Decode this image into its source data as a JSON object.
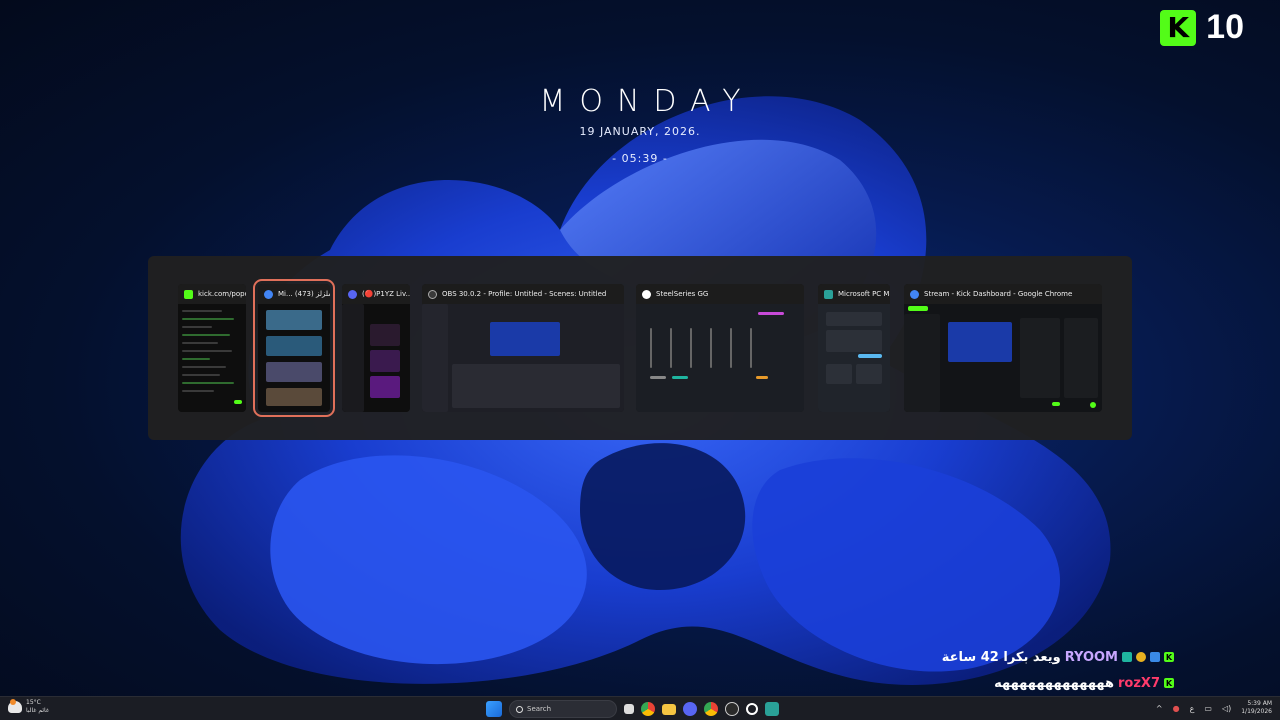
{
  "kick_overlay": {
    "viewer_count": "10",
    "logo_letter": "K"
  },
  "clock": {
    "day": "MONDAY",
    "date": "19 JANUARY, 2026.",
    "time": "- 05:39 -"
  },
  "switcher": {
    "windows": [
      {
        "title": "kick.com/popo...",
        "icon_color": "#53fc18",
        "selected": false
      },
      {
        "title": "Mi... ملزلز (473)",
        "icon_color": "#4285f4",
        "selected": true
      },
      {
        "title": "(🔴)P1YZ Liv...",
        "icon_color": "#5865f2",
        "selected": false
      },
      {
        "title": "OBS 30.0.2 - Profile: Untitled - Scenes: Untitled",
        "icon_color": "#3a3a3a",
        "selected": false
      },
      {
        "title": "SteelSeries GG",
        "icon_color": "#ffffff",
        "selected": false
      },
      {
        "title": "Microsoft PC Ma...",
        "icon_color": "#2aa198",
        "selected": false
      },
      {
        "title": "Stream - Kick Dashboard - Google Chrome",
        "icon_color": "#4285f4",
        "selected": false
      }
    ]
  },
  "chat": {
    "messages": [
      {
        "user": "RYOOM",
        "text": "ويعد بكرا 42 ساعة"
      },
      {
        "user": "rozX7",
        "text": "هههههههههههههه"
      },
      {
        "user": "rozX7",
        "text": ""
      }
    ]
  },
  "taskbar": {
    "weather": {
      "temp": "15°C",
      "desc": "غائم غالبا"
    },
    "search_placeholder": "Search",
    "tray": {
      "lang": "ع",
      "time": "5:39 AM",
      "date": "1/19/2026"
    }
  },
  "colors": {
    "kick_green": "#53fc18",
    "selection": "#e0705a",
    "taskbar": "#1b1d24"
  }
}
